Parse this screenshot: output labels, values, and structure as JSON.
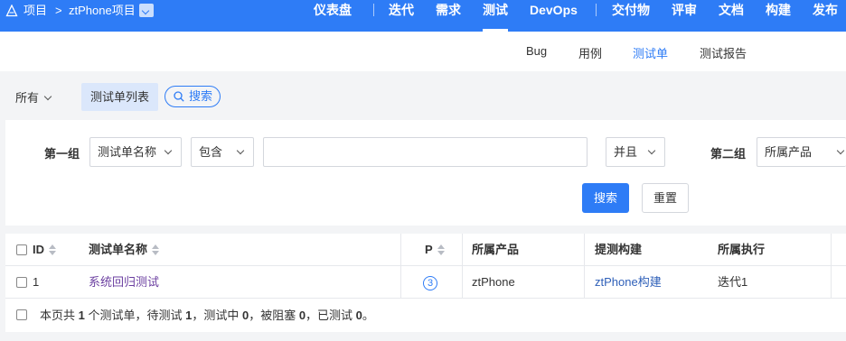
{
  "topbar": {
    "crumb_project": "项目",
    "crumb_sep": ">",
    "crumb_current": "ztPhone项目",
    "nav": [
      "仪表盘",
      "迭代",
      "需求",
      "测试",
      "DevOps",
      "交付物",
      "评审",
      "文档",
      "构建",
      "发布"
    ],
    "active_nav": "测试"
  },
  "subnav": {
    "items": [
      "Bug",
      "用例",
      "测试单",
      "测试报告"
    ],
    "active": "测试单"
  },
  "filterbar": {
    "all_label": "所有",
    "list_tab": "测试单列表",
    "search_label": "搜索"
  },
  "search_panel": {
    "group1_label": "第一组",
    "group1_field": "测试单名称",
    "group1_operator": "包含",
    "group1_value": "",
    "and_or": "并且",
    "group2_label": "第二组",
    "group2_field": "所属产品",
    "search_button": "搜索",
    "reset_button": "重置"
  },
  "table": {
    "headers": {
      "id": "ID",
      "name": "测试单名称",
      "pri": "P",
      "product": "所属产品",
      "build": "提测构建",
      "execution": "所属执行"
    },
    "rows": [
      {
        "id": "1",
        "name": "系统回归测试",
        "pri": "3",
        "product": "ztPhone",
        "build": "ztPhone构建",
        "execution": "迭代1"
      }
    ],
    "footer": {
      "p1": "本页共 ",
      "total": "1",
      "p2": " 个测试单，待测试 ",
      "waiting": "1",
      "p3": "，测试中 ",
      "testing": "0",
      "p4": "，被阻塞 ",
      "blocked": "0",
      "p5": "，已测试 ",
      "done": "0",
      "p6": "。"
    }
  },
  "colors": {
    "primary": "#2e7cf6",
    "link_purple": "#6b3fa0",
    "link_blue": "#2e5fb8",
    "tab_bg": "#dbe7fb"
  }
}
